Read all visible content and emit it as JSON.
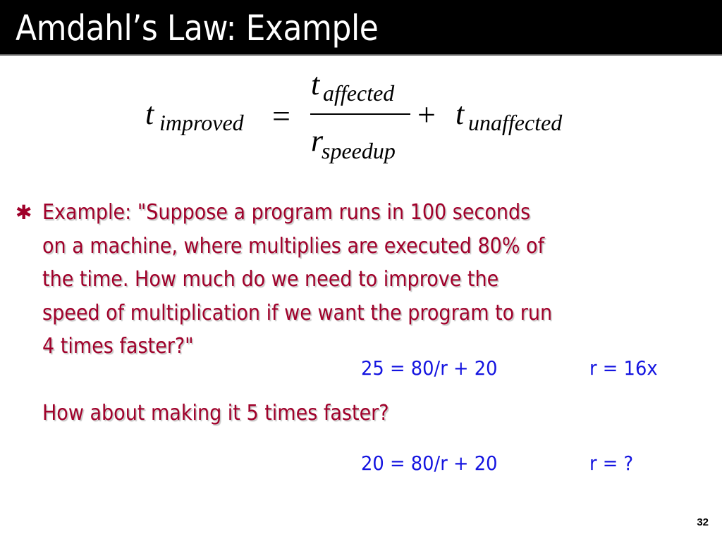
{
  "slide": {
    "title": "Amdahl’s Law:  Example",
    "formula": {
      "lhs_var": "t",
      "lhs_sub": "improved",
      "equals": "=",
      "num_var": "t",
      "num_sub": "affected",
      "den_var": "r",
      "den_sub": "speedup",
      "plus": "+",
      "rhs_var": "t",
      "rhs_sub": "unaffected"
    },
    "bullet": {
      "icon": "asterisk-bullet-icon",
      "lines": [
        "Example:  \"Suppose a program runs in 100 seconds",
        "on a machine, where multiplies are executed 80% of",
        "the time. How much do we need to improve the",
        "speed of multiplication if we want the program to run",
        "4 times faster?\""
      ]
    },
    "answer1": {
      "equation": "25 = 80/r + 20",
      "result": "r = 16x"
    },
    "question2": "How about making it 5 times faster?",
    "answer2": {
      "equation": "20 = 80/r + 20",
      "result": "r = ?"
    },
    "page_number": "32"
  }
}
